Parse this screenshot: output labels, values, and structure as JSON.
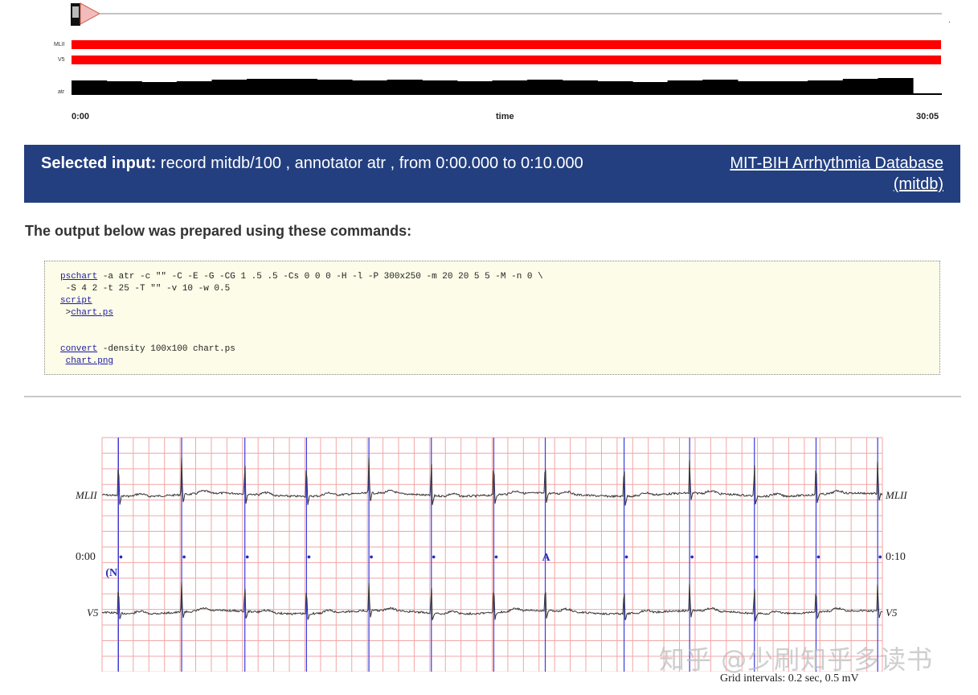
{
  "overview": {
    "tracks": [
      "MLII",
      "V5",
      "atr"
    ],
    "time_start": "0:00",
    "time_axis_label": "time",
    "time_end": "30:05",
    "marker": "."
  },
  "banner": {
    "label": "Selected input:",
    "description": "record mitdb/100 , annotator atr , from 0:00.000 to 0:10.000",
    "database_link": "MIT-BIH Arrhythmia Database (mitdb)"
  },
  "output_heading": "The output below was prepared using these commands:",
  "commands": {
    "pschart_cmd": "pschart",
    "pschart_args_1": " -a atr -c \"\" -C -E -G -CG 1 .5 .5 -Cs 0 0 0 -H -l -P 300x250 -m 20 20 5 5 -M -n 0 \\",
    "pschart_args_2": " -S 4 2 -t 25 -T \"\" -v 10 -w 0.5",
    "script_link": "script",
    "redirect_prefix": " >",
    "chart_ps_link": "chart.ps",
    "convert_cmd": "convert",
    "convert_args": " -density 100x100 chart.ps",
    "chart_png_prefix": " ",
    "chart_png_link": "chart.png"
  },
  "chart_data": {
    "type": "line",
    "signals": [
      "MLII",
      "V5"
    ],
    "time_start": "0:00",
    "time_end": "0:10",
    "x_range_sec": [
      0,
      10
    ],
    "grid": true,
    "grid_major_sec": 0.2,
    "grid_major_mV": 0.5,
    "beat_times_sec": [
      0.21,
      1.02,
      1.83,
      2.62,
      3.42,
      4.22,
      5.02,
      5.68,
      6.69,
      7.53,
      8.36,
      9.15,
      9.94
    ],
    "annotations": [
      {
        "time_sec": 0.21,
        "symbol": "•",
        "aux": "(N"
      },
      {
        "time_sec": 1.02,
        "symbol": "•"
      },
      {
        "time_sec": 1.83,
        "symbol": "•"
      },
      {
        "time_sec": 2.62,
        "symbol": "•"
      },
      {
        "time_sec": 3.42,
        "symbol": "•"
      },
      {
        "time_sec": 4.22,
        "symbol": "•"
      },
      {
        "time_sec": 5.02,
        "symbol": "•"
      },
      {
        "time_sec": 5.68,
        "symbol": "A"
      },
      {
        "time_sec": 6.69,
        "symbol": "•"
      },
      {
        "time_sec": 7.53,
        "symbol": "•"
      },
      {
        "time_sec": 8.36,
        "symbol": "•"
      },
      {
        "time_sec": 9.15,
        "symbol": "•"
      },
      {
        "time_sec": 9.94,
        "symbol": "•"
      }
    ],
    "grid_caption": "Grid intervals: 0.2 sec, 0.5 mV",
    "colors": {
      "grid": "#f2a6a6",
      "annotation_line": "#3b3bdd",
      "trace": "#333333",
      "signal_bar": "#ff0000"
    }
  },
  "watermark": "知乎 @少刷知乎多读书"
}
